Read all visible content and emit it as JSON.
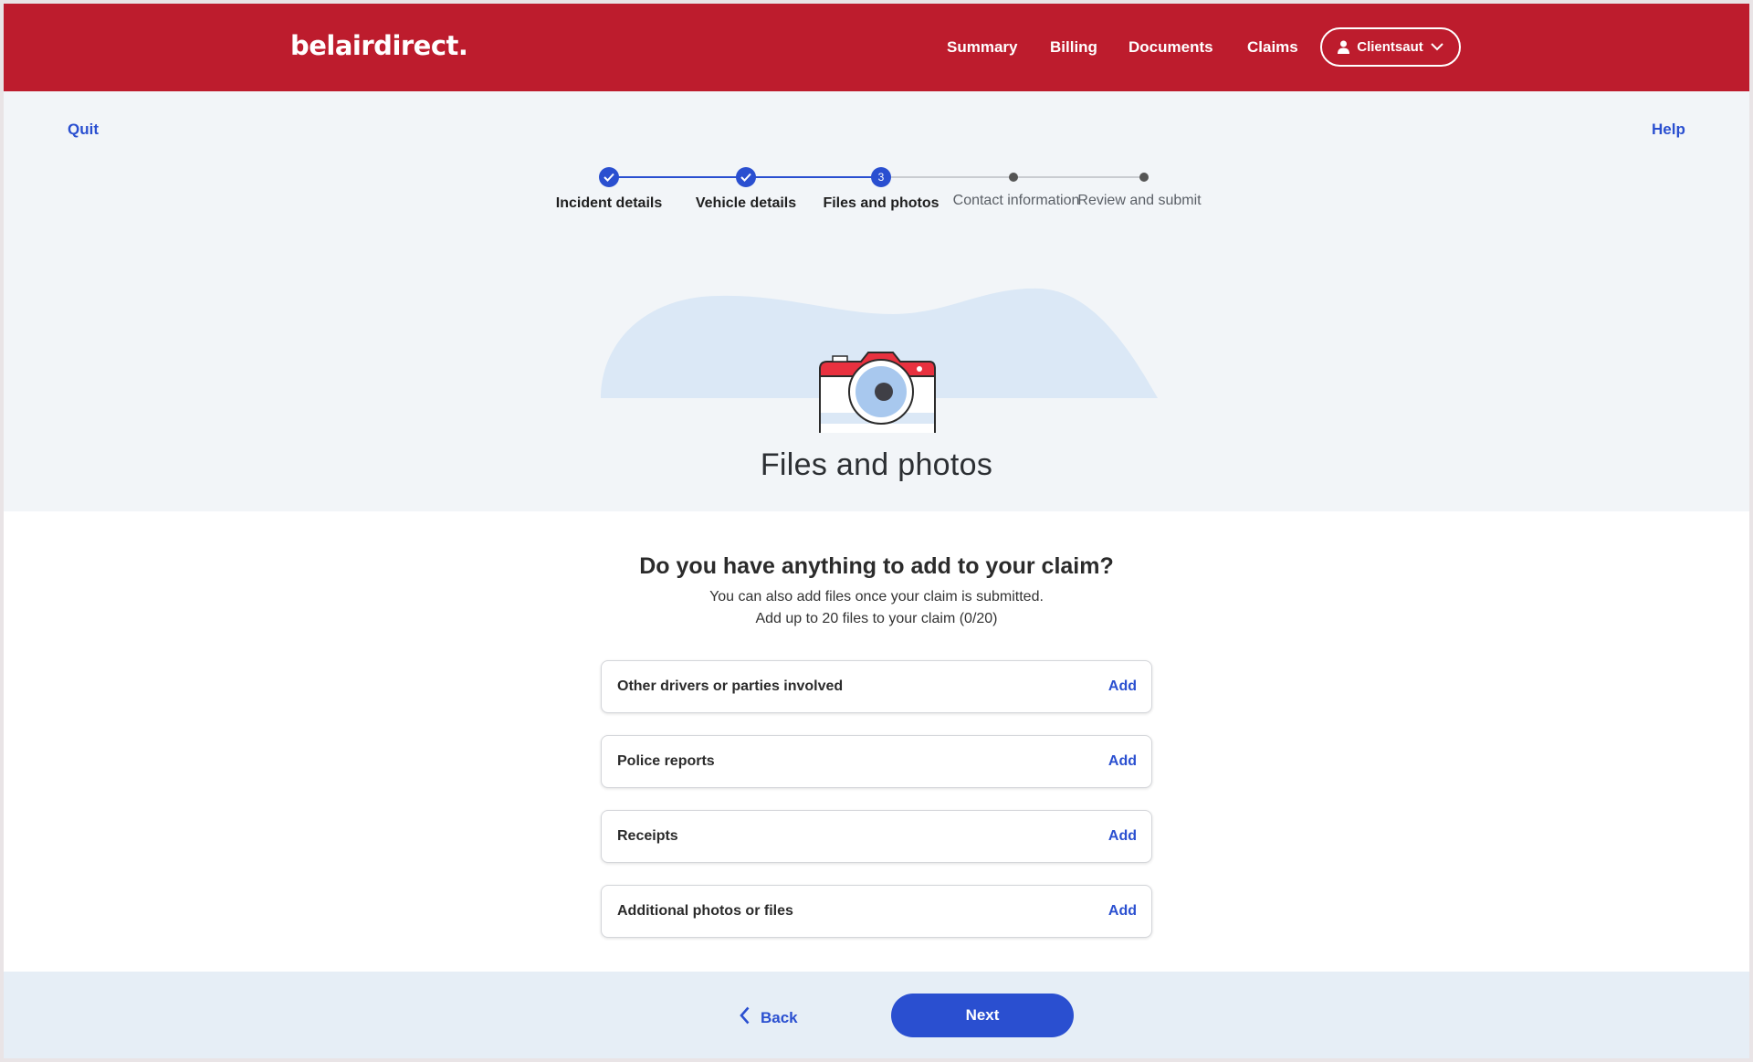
{
  "header": {
    "logo": "belairdirect.",
    "nav": [
      "Summary",
      "Billing",
      "Documents",
      "Claims"
    ],
    "account_label": "Clientsaut",
    "brand_color": "#bd1c2d"
  },
  "toplinks": {
    "quit": "Quit",
    "help": "Help"
  },
  "stepper": {
    "current_step": "3",
    "steps": [
      "Incident details",
      "Vehicle details",
      "Files and photos",
      "Contact information",
      "Review and submit"
    ]
  },
  "hero": {
    "title": "Files and photos"
  },
  "content": {
    "question": "Do you have anything to add to your claim?",
    "subtitle_1": "You can also add files once your claim is submitted.",
    "subtitle_2": "Add up to 20 files to your claim (0/20)",
    "categories": [
      {
        "label": "Other drivers or parties involved",
        "action": "Add"
      },
      {
        "label": "Police reports",
        "action": "Add"
      },
      {
        "label": "Receipts",
        "action": "Add"
      },
      {
        "label": "Additional photos or files",
        "action": "Add"
      }
    ]
  },
  "footer": {
    "back": "Back",
    "next": "Next",
    "accent_color": "#2a4fd0"
  }
}
